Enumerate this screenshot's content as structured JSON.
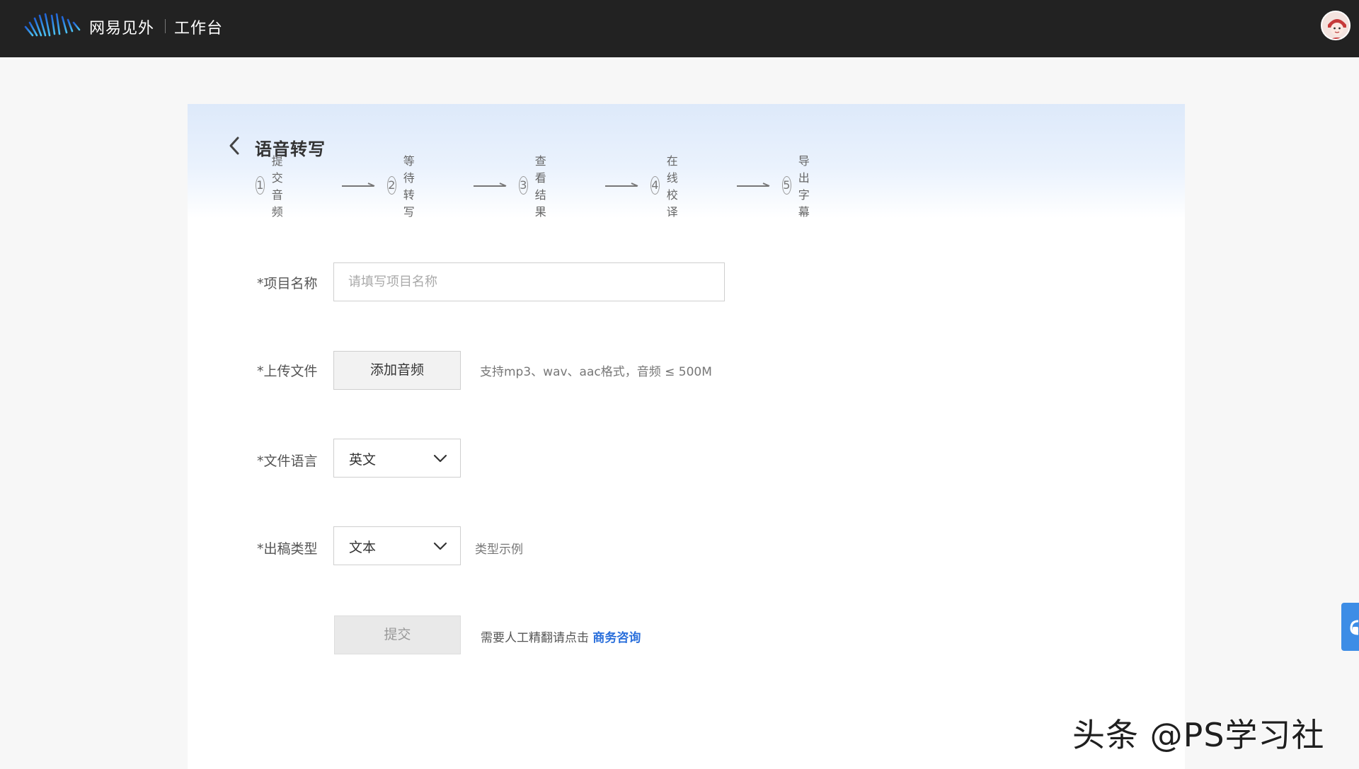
{
  "header": {
    "brand_name": "网易见外",
    "workspace_label": "工作台",
    "logo_icon": "waveform-logo-icon",
    "avatar_icon": "user-avatar-icon"
  },
  "page": {
    "title": "语音转写",
    "back_icon": "chevron-left-icon"
  },
  "steps": [
    {
      "number": "1",
      "label": "提交音频"
    },
    {
      "number": "2",
      "label": "等待转写"
    },
    {
      "number": "3",
      "label": "查看结果"
    },
    {
      "number": "4",
      "label": "在线校译"
    },
    {
      "number": "5",
      "label": "导出字幕"
    }
  ],
  "form": {
    "project_name": {
      "label": "*项目名称",
      "placeholder": "请填写项目名称",
      "value": ""
    },
    "upload": {
      "label": "*上传文件",
      "button_label": "添加音频",
      "hint": "支持mp3、wav、aac格式，音频 ≤ 500M"
    },
    "language": {
      "label": "*文件语言",
      "selected": "英文"
    },
    "output_type": {
      "label": "*出稿类型",
      "selected": "文本",
      "example_link": "类型示例"
    },
    "submit": {
      "button_label": "提交",
      "note": "需要人工精翻请点击",
      "link_label": "商务咨询"
    }
  },
  "colors": {
    "topbar": "#222222",
    "accent_blue": "#2a6fdb",
    "side_tab": "#3d8de6"
  },
  "watermark": "头条 @PS学习社"
}
